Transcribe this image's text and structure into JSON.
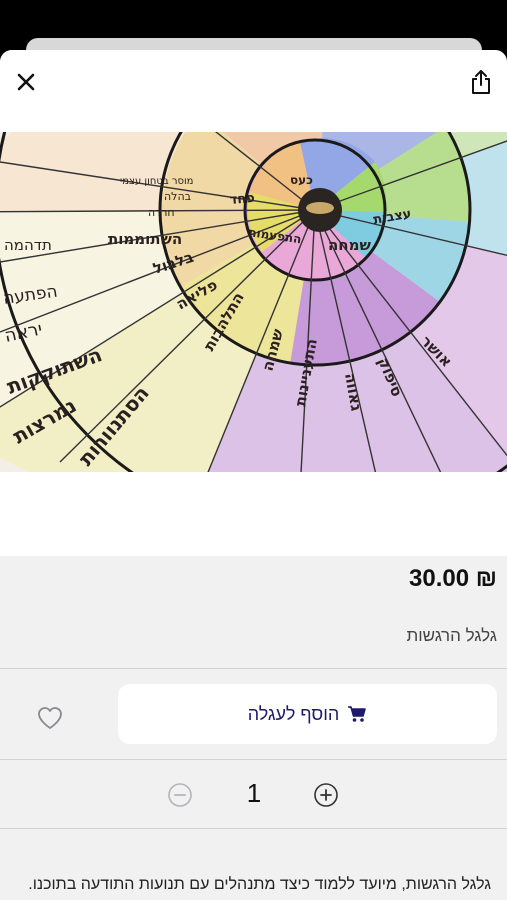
{
  "header": {
    "close_icon": "close-icon",
    "share_icon": "share-icon"
  },
  "product": {
    "image": {
      "wheel_labels": [
        "פחד",
        "התפעמות",
        "שמחה",
        "עצבות",
        "כעס",
        "השתוממות",
        "בלבול",
        "פליאה",
        "התלהבות",
        "שמחה",
        "התעניינות",
        "גאווה",
        "סיפוק",
        "אושר",
        "השתוקקות",
        "נמרצות",
        "הסתנוורות",
        "חרדה",
        "בהלה",
        "מוסר בטחון עצמי",
        "תדהמה",
        "יראה",
        "הפתעה"
      ]
    },
    "price": "₪ 30.00",
    "title": "גלגל הרגשות",
    "add_to_cart_label": "הוסף לעגלה",
    "quantity": "1",
    "description": "גלגל הרגשות, מיועד ללמוד כיצד מתנהלים עם תנועות התודעה בתוכנו."
  },
  "colors": {
    "accent": "#1f1a6b",
    "background": "#f1f1f2"
  }
}
